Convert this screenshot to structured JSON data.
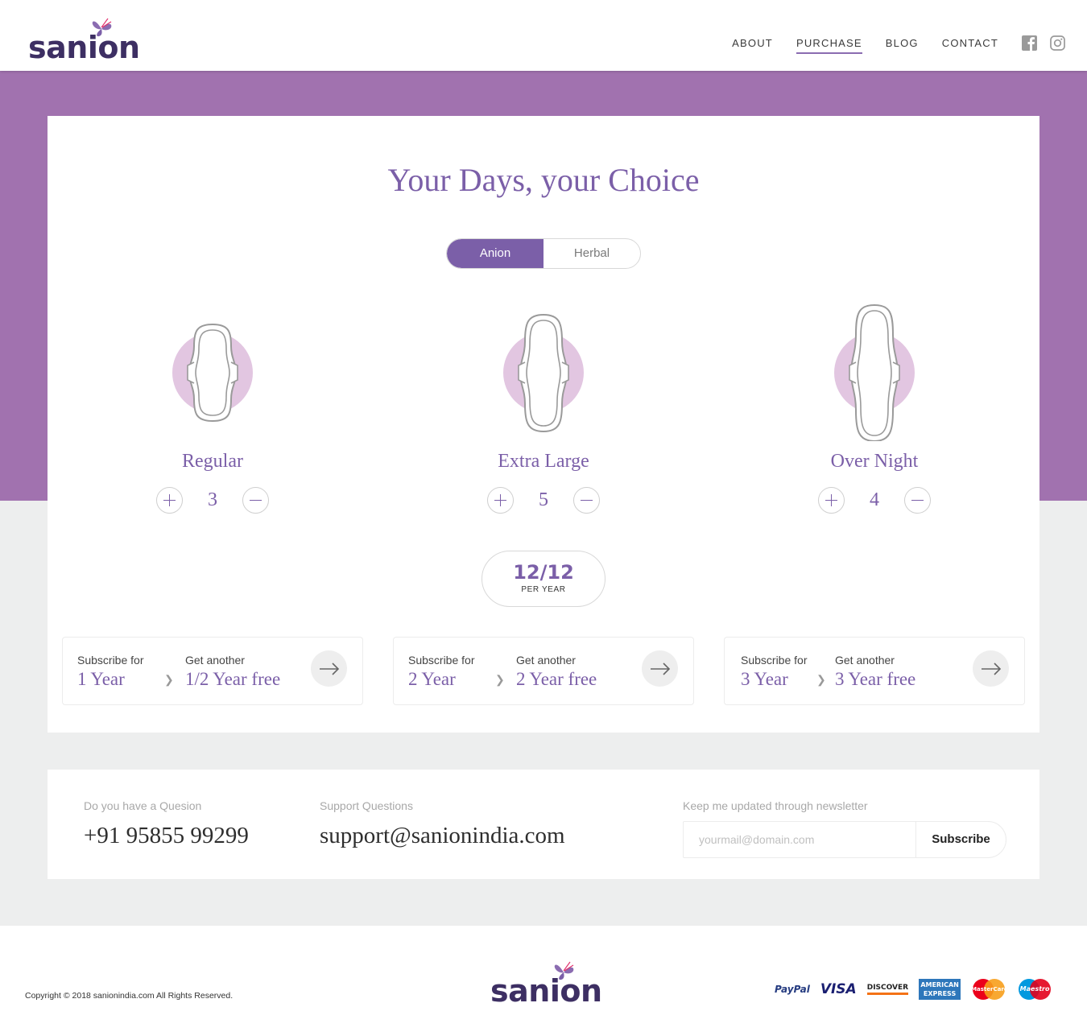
{
  "brand": {
    "name": "sanion"
  },
  "nav": {
    "items": [
      "ABOUT",
      "PURCHASE",
      "BLOG",
      "CONTACT"
    ],
    "active": "PURCHASE"
  },
  "social": {
    "icons": [
      "facebook-icon",
      "instagram-icon"
    ]
  },
  "hero": {
    "title": "Your Days, your Choice"
  },
  "toggle": {
    "options": [
      "Anion",
      "Herbal"
    ],
    "selected": "Anion"
  },
  "products": [
    {
      "name": "Regular",
      "qty": "3"
    },
    {
      "name": "Extra Large",
      "qty": "5"
    },
    {
      "name": "Over Night",
      "qty": "4"
    }
  ],
  "summary": {
    "value": "12/12",
    "label": "PER YEAR"
  },
  "offers": [
    {
      "sub_label": "Subscribe for",
      "sub_value": "1 Year",
      "get_label": "Get another",
      "get_value": "1/2 Year free"
    },
    {
      "sub_label": "Subscribe for",
      "sub_value": "2 Year",
      "get_label": "Get another",
      "get_value": "2 Year free"
    },
    {
      "sub_label": "Subscribe for",
      "sub_value": "3 Year",
      "get_label": "Get another",
      "get_value": "3 Year free"
    }
  ],
  "contact": {
    "question_label": "Do you have a Quesion",
    "phone": "+91 95855 99299",
    "support_label": "Support Questions",
    "email": "support@sanionindia.com",
    "newsletter_label": "Keep me updated through newsletter",
    "newsletter_placeholder": "yourmail@domain.com",
    "subscribe_label": "Subscribe"
  },
  "footer": {
    "copyright": "Copyright © 2018 sanionindia.com All Rights Reserved.",
    "payments": [
      "PayPal",
      "VISA",
      "DISCOVER",
      "AMERICAN EXPRESS",
      "MasterCard",
      "Maestro"
    ]
  },
  "colors": {
    "accent": "#7b5fa8",
    "band": "#a172af",
    "logo": "#3d2f63",
    "pad_circle": "#e2c6e1"
  }
}
